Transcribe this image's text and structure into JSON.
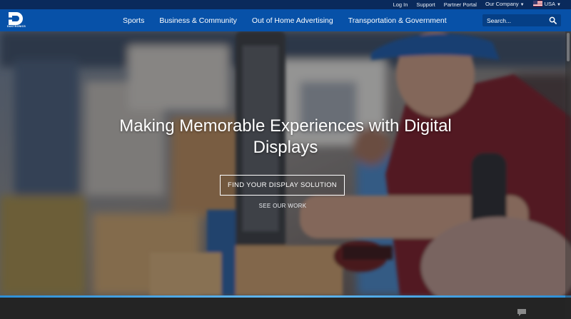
{
  "utility_nav": {
    "items": [
      {
        "label": "Log In"
      },
      {
        "label": "Support"
      },
      {
        "label": "Partner Portal"
      },
      {
        "label": "Our Company",
        "dropdown": true
      }
    ],
    "country": {
      "label": "USA",
      "icon": "us-flag-icon"
    }
  },
  "brand": {
    "logo_text": "DAKTRONICS"
  },
  "main_nav": {
    "items": [
      {
        "label": "Sports"
      },
      {
        "label": "Business & Community"
      },
      {
        "label": "Out of Home Advertising"
      },
      {
        "label": "Transportation & Government"
      }
    ]
  },
  "search": {
    "placeholder": "Search...",
    "icon": "search-icon"
  },
  "hero": {
    "title": "Making Memorable Experiences with Digital Displays",
    "primary_cta": "FIND YOUR DISPLAY SOLUTION",
    "secondary_cta": "SEE OUR WORK"
  },
  "colors": {
    "utility_bar": "#0a2a5c",
    "nav_bar": "#0751a8",
    "accent_line": "#2e8fd6",
    "footer_band": "#242424"
  }
}
